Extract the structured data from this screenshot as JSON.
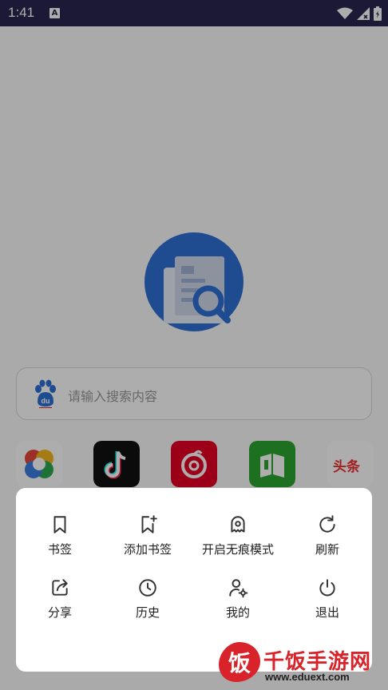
{
  "status_bar": {
    "time": "1:41",
    "notification_icon": "A"
  },
  "search": {
    "placeholder": "请输入搜索内容",
    "engine_icon_text": "du"
  },
  "shortcuts": [
    {
      "name": "photos-app-icon"
    },
    {
      "name": "tiktok-app-icon"
    },
    {
      "name": "netease-music-app-icon"
    },
    {
      "name": "reader-app-icon"
    },
    {
      "name": "toutiao-app-icon",
      "text": "头条"
    }
  ],
  "menu": {
    "items": [
      {
        "label": "书签",
        "icon": "bookmark-icon"
      },
      {
        "label": "添加书签",
        "icon": "add-bookmark-icon"
      },
      {
        "label": "开启无痕模式",
        "icon": "incognito-ghost-icon"
      },
      {
        "label": "刷新",
        "icon": "refresh-icon"
      },
      {
        "label": "分享",
        "icon": "share-icon"
      },
      {
        "label": "历史",
        "icon": "history-clock-icon"
      },
      {
        "label": "我的",
        "icon": "user-settings-icon"
      },
      {
        "label": "退出",
        "icon": "power-icon"
      }
    ]
  },
  "watermark": {
    "title": "千饭手游网",
    "url": "www.eduext.com",
    "logo_text": "饭"
  },
  "colors": {
    "status_bar": "#2a2550",
    "brand_blue": "#2f6fd6",
    "watermark_red": "#d9232b"
  }
}
